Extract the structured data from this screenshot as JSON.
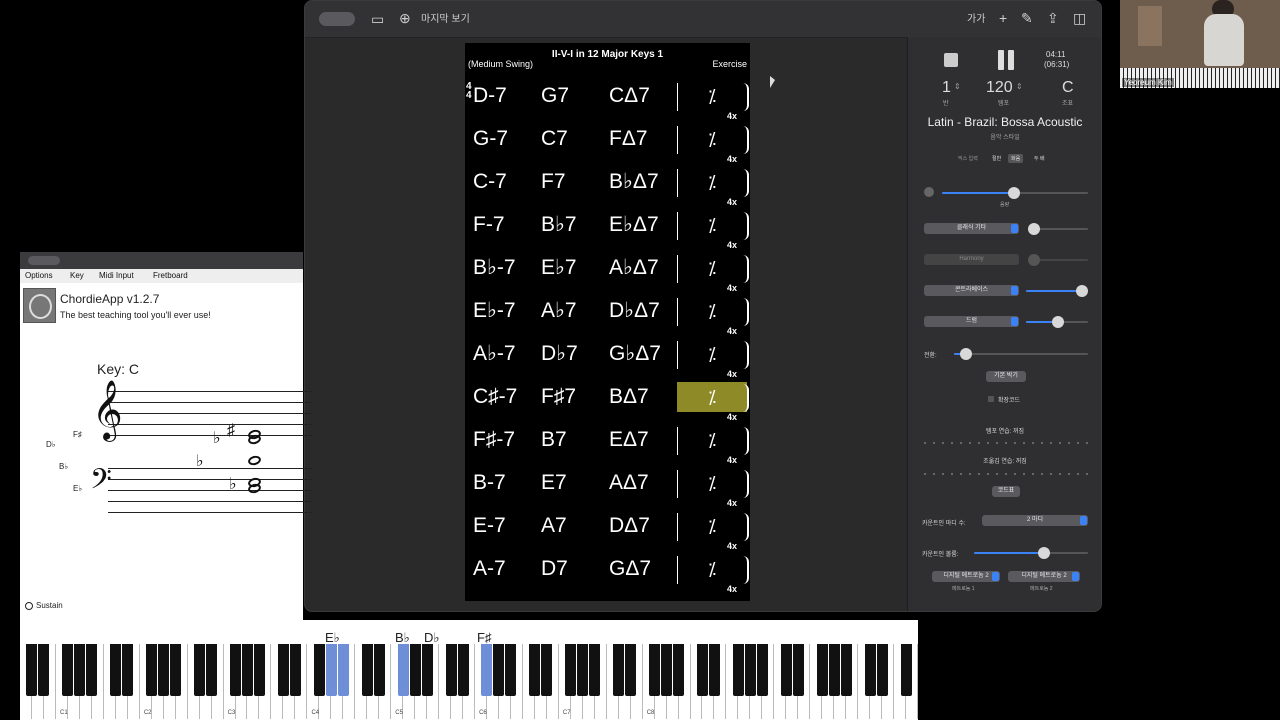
{
  "ireal": {
    "toolbar": {
      "title": "마지막 보기",
      "font_btn": "가가"
    },
    "sheet": {
      "title": "II-V-I in 12 Major Keys 1",
      "style": "(Medium Swing)",
      "composer": "Exercise",
      "time_sig_top": "4",
      "time_sig_bottom": "4",
      "repeat_count": "4x",
      "rows": [
        [
          "D-7",
          "G7",
          "CΔ7"
        ],
        [
          "G-7",
          "C7",
          "FΔ7"
        ],
        [
          "C-7",
          "F7",
          "B♭Δ7"
        ],
        [
          "F-7",
          "B♭7",
          "E♭Δ7"
        ],
        [
          "B♭-7",
          "E♭7",
          "A♭Δ7"
        ],
        [
          "E♭-7",
          "A♭7",
          "D♭Δ7"
        ],
        [
          "A♭-7",
          "D♭7",
          "G♭Δ7"
        ],
        [
          "C♯-7",
          "F♯7",
          "BΔ7"
        ],
        [
          "F♯-7",
          "B7",
          "EΔ7"
        ],
        [
          "B-7",
          "E7",
          "AΔ7"
        ],
        [
          "E-7",
          "A7",
          "DΔ7"
        ],
        [
          "A-7",
          "D7",
          "GΔ7"
        ]
      ],
      "repeat_symbol": "⁒",
      "highlight_row": 7
    },
    "panel": {
      "time_elapsed": "04:11",
      "time_total": "(06:31)",
      "chorus": "1",
      "chorus_label": "반",
      "tempo": "120",
      "tempo_label": "템포",
      "key": "C",
      "key_label": "조표",
      "style_name": "Latin - Brazil: Bossa Acoustic",
      "style_sub": "음악 스타일",
      "mix_tabs": [
        "믹스 입력",
        "절반",
        "화음",
        "두 배"
      ],
      "volume_label": "음량",
      "inst1": "클래식 기타",
      "inst2": "Harmony",
      "inst3": "콘트라베이스",
      "inst4": "드럼",
      "transpose_label": "전환:",
      "default_btn": "기본 박기",
      "ext_chords": "확장코드",
      "tempo_practice": "템포 연습: 꺼짐",
      "key_practice": "조옮김 연습: 꺼짐",
      "chords_btn": "코드표",
      "countin_label": "카운트인 마디 수:",
      "countin_value": "2 마디",
      "countin_vol": "카운트인 볼륨:",
      "metro1": "디지털 메트로놈 2",
      "metro1_sub": "메트로놈 1",
      "metro2": "디지털 메트로놈 2",
      "metro2_sub": "메트로놈 2"
    }
  },
  "chordie": {
    "menu": [
      "Options",
      "Key",
      "Midi Input",
      "Fretboard"
    ],
    "app_name": "ChordieApp v1.2.7",
    "tagline": "The best teaching tool you'll ever use!",
    "key_label": "Key: C",
    "note_labels": [
      "F♯",
      "D♭",
      "B♭",
      "E♭"
    ],
    "sustain": "Sustain"
  },
  "piano": {
    "pressed_labels": [
      "E♭",
      "B♭",
      "D♭",
      "F♯"
    ],
    "octaves": [
      "C1",
      "C2",
      "C3",
      "C4",
      "C5",
      "C6",
      "C7",
      "C8"
    ]
  },
  "webcam": {
    "name": "Yeoreum Kim"
  }
}
